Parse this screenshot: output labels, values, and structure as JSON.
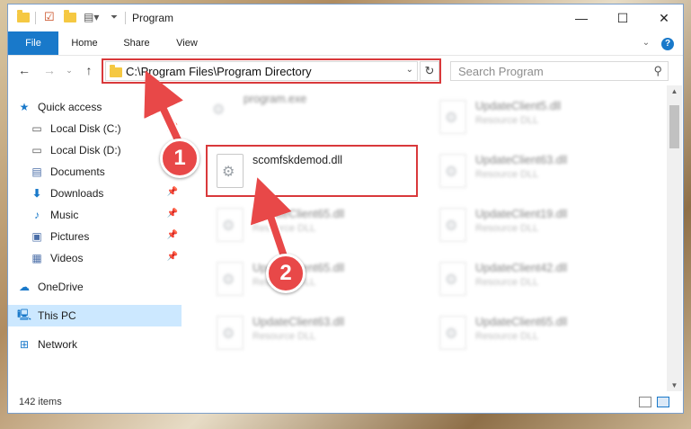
{
  "window": {
    "title": "Program",
    "controls": {
      "minimize": "—",
      "maximize": "☐",
      "close": "✕"
    }
  },
  "ribbon": {
    "tabs": [
      "File",
      "Home",
      "Share",
      "View"
    ]
  },
  "address_bar": {
    "path": "C:\\Program Files\\Program Directory"
  },
  "search": {
    "placeholder": "Search Program"
  },
  "nav_pane": {
    "items": [
      {
        "label": "Quick access",
        "icon": "star-icon"
      },
      {
        "label": "Local Disk (C:)",
        "icon": "drive-icon"
      },
      {
        "label": "Local Disk (D:)",
        "icon": "drive-icon"
      },
      {
        "label": "Documents",
        "icon": "documents-icon"
      },
      {
        "label": "Downloads",
        "icon": "download-icon"
      },
      {
        "label": "Music",
        "icon": "music-icon"
      },
      {
        "label": "Pictures",
        "icon": "pictures-icon"
      },
      {
        "label": "Videos",
        "icon": "videos-icon"
      },
      {
        "label": "OneDrive",
        "icon": "cloud-icon"
      },
      {
        "label": "This PC",
        "icon": "computer-icon"
      },
      {
        "label": "Network",
        "icon": "network-icon"
      }
    ]
  },
  "files": {
    "highlighted": {
      "name": "scomfskdemod.dll",
      "type": ""
    },
    "left_column": [
      {
        "name": "program.exe",
        "type": ""
      },
      {
        "name": "UpdateClient65.dll",
        "type": "Resource DLL"
      },
      {
        "name": "UpdateClient65.dll",
        "type": "Resource DLL"
      },
      {
        "name": "UpdateClient63.dll",
        "type": "Resource DLL"
      }
    ],
    "right_column": [
      {
        "name": "UpdateClient5.dll",
        "type": "Resource DLL"
      },
      {
        "name": "UpdateClient63.dll",
        "type": "Resource DLL"
      },
      {
        "name": "UpdateClient19.dll",
        "type": "Resource DLL"
      },
      {
        "name": "UpdateClient42.dll",
        "type": "Resource DLL"
      },
      {
        "name": "UpdateClient65.dll",
        "type": "Resource DLL"
      }
    ]
  },
  "status": {
    "item_count": "142 items"
  },
  "callouts": {
    "step1": "1",
    "step2": "2"
  },
  "colors": {
    "accent": "#1979ca",
    "highlight": "#d9393b",
    "callout": "#e84848"
  }
}
